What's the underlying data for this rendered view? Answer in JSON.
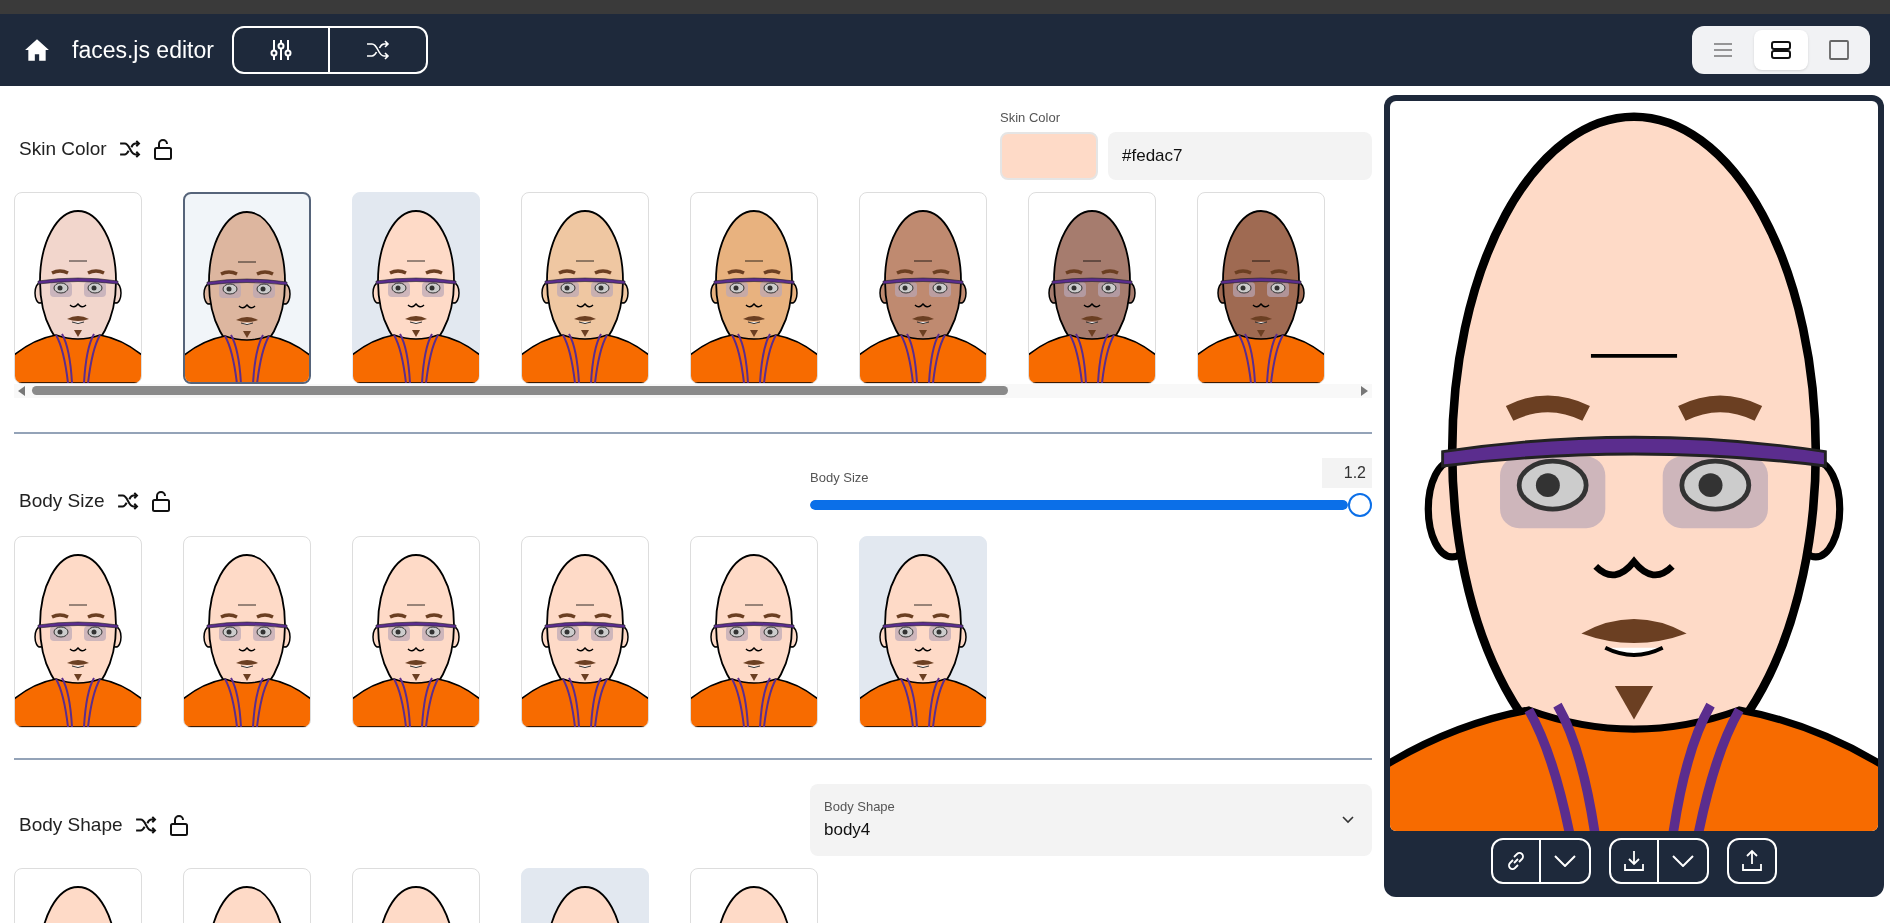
{
  "app": {
    "title": "faces.js editor"
  },
  "layout_toggle": [
    {
      "kind": "list",
      "selected": false
    },
    {
      "kind": "rows",
      "selected": true
    },
    {
      "kind": "single",
      "selected": false
    }
  ],
  "sections": [
    {
      "title": "Skin Color",
      "control": {
        "kind": "color",
        "label": "Skin Color",
        "value": "#fedac7"
      },
      "options": [
        {
          "color": "#f2d6cc",
          "selected": false,
          "highlighted": false
        },
        {
          "color": "#ddb69f",
          "selected": false,
          "highlighted": true
        },
        {
          "color": "#fedac7",
          "selected": true,
          "highlighted": false
        },
        {
          "color": "#efc7a2",
          "selected": false,
          "highlighted": false
        },
        {
          "color": "#e8b27f",
          "selected": false,
          "highlighted": false
        },
        {
          "color": "#bf8a70",
          "selected": false,
          "highlighted": false
        },
        {
          "color": "#a67c6e",
          "selected": false,
          "highlighted": false
        },
        {
          "color": "#9f6a52",
          "selected": false,
          "highlighted": false
        }
      ]
    },
    {
      "title": "Body Size",
      "control": {
        "kind": "slider",
        "label": "Body Size",
        "value": "1.2",
        "level": 1
      },
      "options": [
        {
          "selected": false,
          "highlighted": false
        },
        {
          "selected": false,
          "highlighted": false
        },
        {
          "selected": false,
          "highlighted": false
        },
        {
          "selected": false,
          "highlighted": false
        },
        {
          "selected": false,
          "highlighted": false
        },
        {
          "selected": true,
          "highlighted": false
        }
      ]
    },
    {
      "title": "Body Shape",
      "control": {
        "kind": "select",
        "label": "Body Shape",
        "value": "body4"
      },
      "options": [
        {
          "selected": false,
          "highlighted": false
        },
        {
          "selected": false,
          "highlighted": false
        },
        {
          "selected": false,
          "highlighted": false
        },
        {
          "selected": true,
          "highlighted": false
        },
        {
          "selected": false,
          "highlighted": false
        }
      ]
    }
  ]
}
